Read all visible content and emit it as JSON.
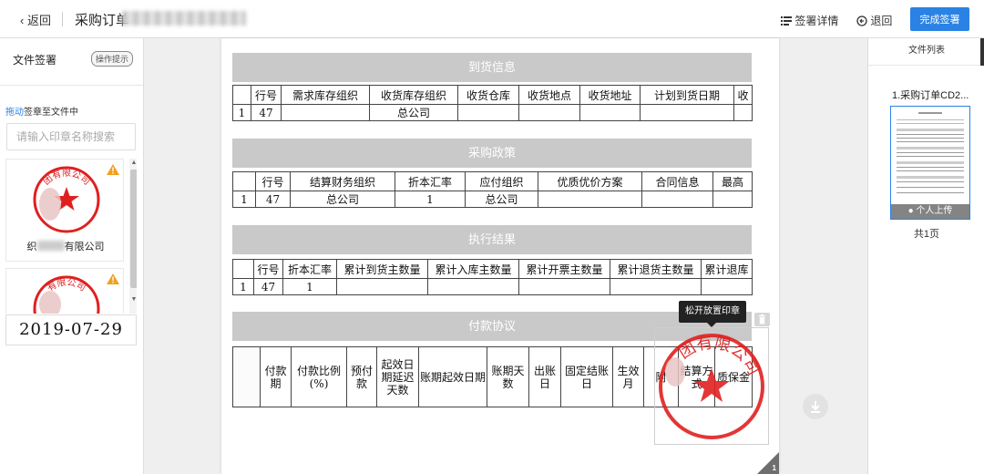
{
  "topbar": {
    "back_label": "返回",
    "title": "采购订单",
    "detail_label": "签署详情",
    "retract_label": "退回",
    "finish_label": "完成签署",
    "accent_color": "#2a82e4"
  },
  "left_panel": {
    "title": "文件签署",
    "op_tip": "操作提示",
    "drag_highlight": "拖动",
    "drag_rest": "签章至文件中",
    "search_placeholder": "请输入印章名称搜索",
    "seals": [
      {
        "name_prefix": "织",
        "name_suffix": "有限公司",
        "seal_text": "团有限公司"
      },
      {
        "seal_text": "有限公司"
      }
    ],
    "date_stamp": "2019-07-29",
    "seal_color": "#e02020"
  },
  "doc": {
    "sec1": {
      "title": "到货信息",
      "headers": [
        "",
        "行号",
        "需求库存组织",
        "收货库存组织",
        "收货仓库",
        "收货地点",
        "收货地址",
        "计划到货日期",
        "收"
      ],
      "row": [
        "1",
        "47",
        "",
        "总公司",
        "",
        "",
        "",
        "",
        ""
      ]
    },
    "sec2": {
      "title": "采购政策",
      "headers": [
        "",
        "行号",
        "结算财务组织",
        "折本汇率",
        "应付组织",
        "优质优价方案",
        "合同信息",
        "最高"
      ],
      "row": [
        "1",
        "47",
        "总公司",
        "1",
        "总公司",
        "",
        "",
        ""
      ]
    },
    "sec3": {
      "title": "执行结果",
      "headers": [
        "",
        "行号",
        "折本汇率",
        "累计到货主数量",
        "累计入库主数量",
        "累计开票主数量",
        "累计退货主数量",
        "累计退库"
      ],
      "row": [
        "1",
        "47",
        "1",
        "",
        "",
        "",
        "",
        ""
      ]
    },
    "sec4": {
      "title": "付款协议",
      "headers": [
        "",
        "付款期",
        "付款比例(%)",
        "预付款",
        "起效日期延迟天数",
        "账期起效日期",
        "账期天数",
        "出账日",
        "固定结账日",
        "生效月",
        "附",
        "结算方式",
        "质保金"
      ]
    },
    "page_number": "1",
    "tooltip": "松开放置印章",
    "placed_seal_text": "团有限公司"
  },
  "right_panel": {
    "title": "文件列表",
    "file_name": "1.采购订单CD2...",
    "thumb_label": "个人上传",
    "page_count": "共1页"
  }
}
